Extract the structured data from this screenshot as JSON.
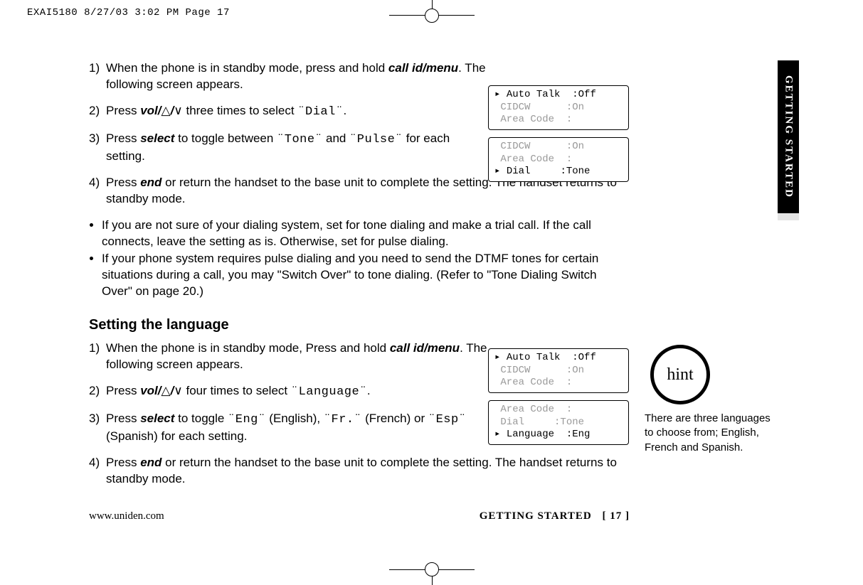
{
  "print_header": "EXAI5180  8/27/03 3:02 PM  Page 17",
  "side_tab": "GETTING STARTED",
  "dial": {
    "step1_num": "1)",
    "step1_a": "When the phone is in standby mode, press and hold ",
    "step1_key": "call id/menu",
    "step1_b": ". The following screen appears.",
    "step2_num": "2)",
    "step2_a": "Press ",
    "step2_key": "vol/",
    "step2_b": " three times to select ",
    "step2_lcd": "¨Dial¨",
    "step2_c": ".",
    "step3_num": "3)",
    "step3_a": "Press ",
    "step3_key": "select",
    "step3_b": " to toggle between ",
    "step3_lcd1": "¨Tone¨",
    "step3_c": " and ",
    "step3_lcd2": "¨Pulse¨",
    "step3_d": " for each setting.",
    "step4_num": "4)",
    "step4_a": "Press ",
    "step4_key": "end",
    "step4_b": " or return the handset to the base unit to complete the setting. The handset returns to standby mode.",
    "bullet1": "If you are not sure of your dialing system, set for tone dialing and make a trial call. If the call connects, leave the setting as is. Otherwise, set for pulse dialing.",
    "bullet2": "If your phone system requires pulse dialing and you need to send the DTMF tones for certain situations during a call, you may \"Switch Over\" to tone dialing. (Refer to \"Tone Dialing Switch Over\" on page 20.)"
  },
  "lang": {
    "heading": "Setting the language",
    "step1_num": "1)",
    "step1_a": "When the phone is in standby mode, Press and hold ",
    "step1_key": "call id/menu",
    "step1_b": ". The following screen appears.",
    "step2_num": "2)",
    "step2_a": "Press ",
    "step2_key": "vol/",
    "step2_b": " four times to select ",
    "step2_lcd": "¨Language¨",
    "step2_c": ".",
    "step3_num": "3)",
    "step3_a": "Press ",
    "step3_key": "select",
    "step3_b": " to toggle ",
    "step3_lcd1": "¨Eng¨",
    "step3_c": " (English), ",
    "step3_lcd2": "¨Fr.¨",
    "step3_d": " (French) or ",
    "step3_lcd3": "¨Esp¨",
    "step3_e": " (Spanish) for each setting.",
    "step4_num": "4)",
    "step4_a": "Press ",
    "step4_key": "end",
    "step4_b": " or return the handset to the base unit to complete the setting. The handset returns to standby mode."
  },
  "lcd1": {
    "l1": " Auto Talk  :Off",
    "l2": " CIDCW      :On",
    "l3": " Area Code  :"
  },
  "lcd2": {
    "l1": " CIDCW      :On",
    "l2": " Area Code  :",
    "l3": " Dial     :Tone"
  },
  "lcd3": {
    "l1": " Auto Talk  :Off",
    "l2": " CIDCW      :On",
    "l3": " Area Code  :"
  },
  "lcd4": {
    "l1": " Area Code  :",
    "l2": " Dial     :Tone",
    "l3": " Language  :Eng"
  },
  "hint": {
    "label": "hint",
    "text": "There are three languages to choose from; English, French and Spanish."
  },
  "footer": {
    "url": "www.uniden.com",
    "section": "GETTING STARTED",
    "page": "[ 17 ]"
  },
  "icons": {
    "up": "△",
    "down": "∨",
    "slash": "/",
    "cursor": "▸"
  }
}
